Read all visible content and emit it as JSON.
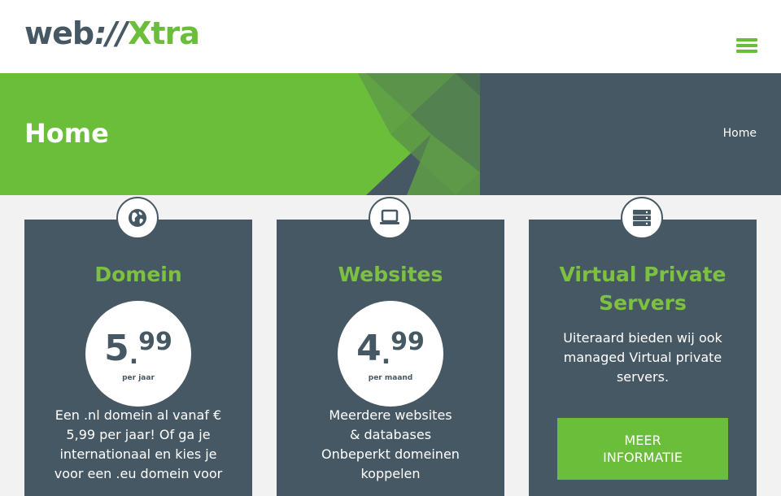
{
  "header": {
    "logo": {
      "part1": "web",
      "part2": "://",
      "part3": "Xtra"
    },
    "menu_icon": "hamburger-menu-icon"
  },
  "banner": {
    "title": "Home",
    "breadcrumb": "Home"
  },
  "colors": {
    "brand_green": "#6abe39",
    "title_green": "#7cc142",
    "slate": "#465863",
    "background": "#f2f2f2"
  },
  "cards": [
    {
      "icon": "globe-icon",
      "title": "Domein",
      "price": {
        "whole": "5",
        "decimals": "99",
        "period": "per jaar"
      },
      "text": [
        "Een .nl domein al vanaf €",
        "5,99 per jaar! Of ga je",
        "internationaal en kies je",
        "voor een .eu domein voor"
      ]
    },
    {
      "icon": "laptop-icon",
      "title": "Websites",
      "price": {
        "whole": "4",
        "decimals": "99",
        "period": "per maand"
      },
      "text": [
        "Meerdere websites",
        "& databases",
        "Onbeperkt domeinen",
        "koppelen"
      ]
    },
    {
      "icon": "server-icon",
      "title": [
        "Virtual Private",
        "Servers"
      ],
      "text": [
        "Uiteraard bieden wij ook",
        "managed Virtual private",
        "servers."
      ],
      "button": [
        "MEER",
        "INFORMATIE"
      ]
    }
  ]
}
